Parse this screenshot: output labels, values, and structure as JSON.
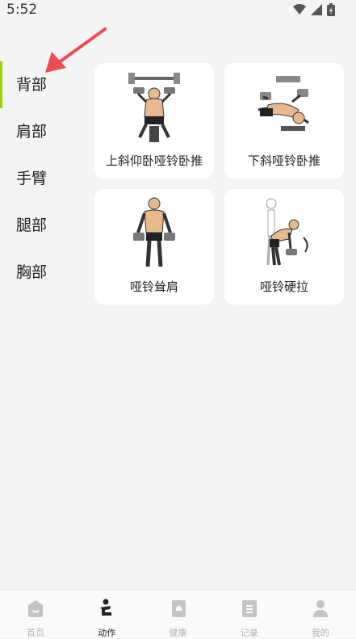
{
  "status_bar": {
    "time": "5:52"
  },
  "sidebar": {
    "items": [
      {
        "label": "背部",
        "active": true
      },
      {
        "label": "肩部"
      },
      {
        "label": "手臂"
      },
      {
        "label": "腿部"
      },
      {
        "label": "胸部"
      }
    ]
  },
  "exercises": [
    {
      "label": "上斜仰卧哑铃卧推"
    },
    {
      "label": "下斜哑铃卧推"
    },
    {
      "label": "哑铃耸肩"
    },
    {
      "label": "哑铃硬拉"
    }
  ],
  "bottom_nav": {
    "items": [
      {
        "label": "首页"
      },
      {
        "label": "动作",
        "active": true
      },
      {
        "label": "健康"
      },
      {
        "label": "记录"
      },
      {
        "label": "我的"
      }
    ]
  },
  "colors": {
    "accent": "#9ad600",
    "annotation_arrow": "#f04b55",
    "inactive_nav": "#c4c4c4",
    "active_nav": "#222222"
  }
}
